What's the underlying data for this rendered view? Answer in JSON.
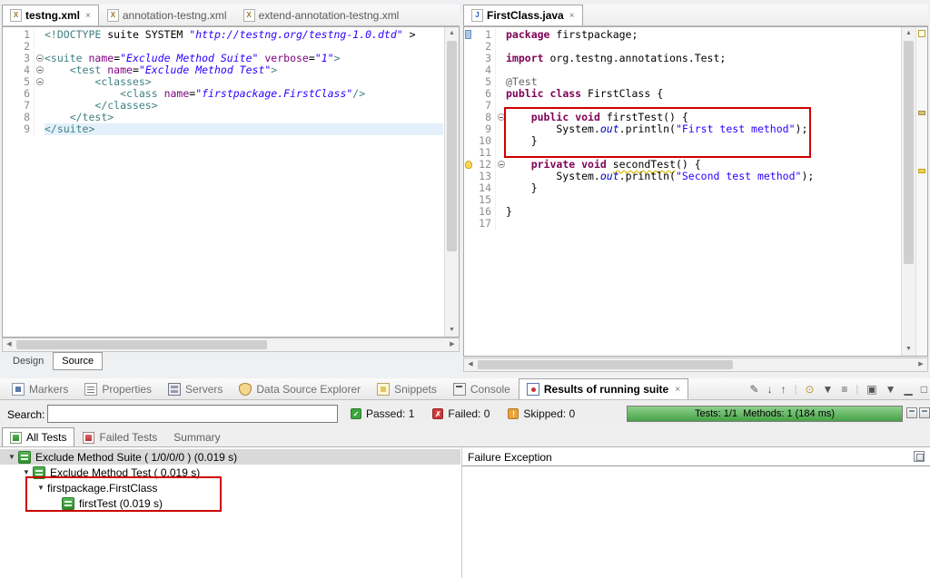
{
  "icons": {
    "close": "×",
    "xml_file": "X",
    "java_file": "J",
    "scroll_up": "▲",
    "scroll_down": "▼",
    "scroll_left": "◀",
    "scroll_right": "▶",
    "tree_expanded": "▼"
  },
  "left_editor": {
    "tabs": [
      {
        "label": "testng.xml",
        "icon": "xml",
        "active": true,
        "closable": true
      },
      {
        "label": "annotation-testng.xml",
        "icon": "xml"
      },
      {
        "label": "extend-annotation-testng.xml",
        "icon": "xml"
      }
    ],
    "bottom_tabs": [
      {
        "label": "Design"
      },
      {
        "label": "Source",
        "active": true
      }
    ],
    "lines": [
      {
        "n": "1",
        "seg": [
          [
            "t",
            "<!DOCTYPE "
          ],
          [
            "p",
            "suite SYSTEM "
          ],
          [
            "v",
            "\"http://testng.org/testng-1.0.dtd\""
          ],
          [
            "p",
            " >"
          ]
        ]
      },
      {
        "n": "2",
        "seg": []
      },
      {
        "n": "3",
        "fold": true,
        "seg": [
          [
            "t",
            "<suite "
          ],
          [
            "a",
            "name"
          ],
          [
            "p",
            "="
          ],
          [
            "v",
            "\"Exclude Method Suite\""
          ],
          [
            "p",
            " "
          ],
          [
            "a",
            "verbose"
          ],
          [
            "p",
            "="
          ],
          [
            "v",
            "\"1\""
          ],
          [
            "t",
            ">"
          ]
        ]
      },
      {
        "n": "4",
        "fold": true,
        "seg": [
          [
            "p",
            "    "
          ],
          [
            "t",
            "<test "
          ],
          [
            "a",
            "name"
          ],
          [
            "p",
            "="
          ],
          [
            "v",
            "\"Exclude Method Test\""
          ],
          [
            "t",
            ">"
          ]
        ]
      },
      {
        "n": "5",
        "fold": true,
        "seg": [
          [
            "p",
            "        "
          ],
          [
            "t",
            "<classes>"
          ]
        ]
      },
      {
        "n": "6",
        "seg": [
          [
            "p",
            "            "
          ],
          [
            "t",
            "<class "
          ],
          [
            "a",
            "name"
          ],
          [
            "p",
            "="
          ],
          [
            "v",
            "\"firstpackage.FirstClass\""
          ],
          [
            "t",
            "/>"
          ]
        ]
      },
      {
        "n": "7",
        "seg": [
          [
            "p",
            "        "
          ],
          [
            "t",
            "</classes>"
          ]
        ]
      },
      {
        "n": "8",
        "seg": [
          [
            "p",
            "    "
          ],
          [
            "t",
            "</test>"
          ]
        ]
      },
      {
        "n": "9",
        "hl": true,
        "seg": [
          [
            "t",
            "</suite>"
          ]
        ]
      }
    ]
  },
  "right_editor": {
    "tabs": [
      {
        "label": "FirstClass.java",
        "icon": "java",
        "active": true,
        "closable": true
      }
    ],
    "lines": [
      {
        "n": "1",
        "mark": "range",
        "seg": [
          [
            "k",
            "package"
          ],
          [
            "p",
            " firstpackage;"
          ]
        ]
      },
      {
        "n": "2",
        "seg": []
      },
      {
        "n": "3",
        "seg": [
          [
            "k",
            "import"
          ],
          [
            "p",
            " org.testng.annotations.Test;"
          ]
        ]
      },
      {
        "n": "4",
        "seg": []
      },
      {
        "n": "5",
        "seg": [
          [
            "an",
            "@Test"
          ]
        ]
      },
      {
        "n": "6",
        "seg": [
          [
            "k",
            "public"
          ],
          [
            "p",
            " "
          ],
          [
            "k",
            "class"
          ],
          [
            "p",
            " FirstClass {"
          ]
        ]
      },
      {
        "n": "7",
        "seg": []
      },
      {
        "n": "8",
        "fold": true,
        "seg": [
          [
            "p",
            "    "
          ],
          [
            "k",
            "public"
          ],
          [
            "p",
            " "
          ],
          [
            "k",
            "void"
          ],
          [
            "p",
            " firstTest() {"
          ]
        ]
      },
      {
        "n": "9",
        "seg": [
          [
            "p",
            "        System."
          ],
          [
            "st",
            "out"
          ],
          [
            "p",
            ".println("
          ],
          [
            "s",
            "\"First test method\""
          ],
          [
            "p",
            ");"
          ]
        ]
      },
      {
        "n": "10",
        "seg": [
          [
            "p",
            "    }"
          ]
        ]
      },
      {
        "n": "11",
        "seg": []
      },
      {
        "n": "12",
        "fold": true,
        "bulb": true,
        "seg": [
          [
            "p",
            "    "
          ],
          [
            "k",
            "private"
          ],
          [
            "p",
            " "
          ],
          [
            "k",
            "void"
          ],
          [
            "p",
            " "
          ],
          [
            "w",
            "secondTest"
          ],
          [
            "p",
            "() {"
          ]
        ]
      },
      {
        "n": "13",
        "seg": [
          [
            "p",
            "        System."
          ],
          [
            "st",
            "out"
          ],
          [
            "p",
            ".println("
          ],
          [
            "s",
            "\"Second test method\""
          ],
          [
            "p",
            ");"
          ]
        ]
      },
      {
        "n": "14",
        "seg": [
          [
            "p",
            "    }"
          ]
        ]
      },
      {
        "n": "15",
        "seg": []
      },
      {
        "n": "16",
        "seg": [
          [
            "p",
            "}"
          ]
        ]
      },
      {
        "n": "17",
        "seg": []
      }
    ]
  },
  "results_panel": {
    "tabs": [
      {
        "label": "Markers",
        "icon": "markers"
      },
      {
        "label": "Properties",
        "icon": "properties"
      },
      {
        "label": "Servers",
        "icon": "servers"
      },
      {
        "label": "Data Source Explorer",
        "icon": "datasource"
      },
      {
        "label": "Snippets",
        "icon": "snippets"
      },
      {
        "label": "Console",
        "icon": "console"
      },
      {
        "label": "Results of running suite",
        "icon": "results",
        "active": true,
        "closable": true
      }
    ],
    "toolbar_icons": [
      {
        "name": "new-report-icon",
        "glyph": "✎"
      },
      {
        "name": "next-failure-icon",
        "glyph": "↓"
      },
      {
        "name": "previous-failure-icon",
        "glyph": "↑"
      },
      {
        "name": "separator",
        "glyph": "|"
      },
      {
        "name": "key-icon",
        "glyph": "⊙",
        "color": "#b8962e"
      },
      {
        "name": "filter-icon",
        "glyph": "▼"
      },
      {
        "name": "history-icon",
        "glyph": "≡"
      },
      {
        "name": "separator",
        "glyph": "|"
      },
      {
        "name": "detach-icon",
        "glyph": "▣"
      },
      {
        "name": "view-menu-icon",
        "glyph": "▼"
      },
      {
        "name": "minimize-icon",
        "glyph": "▁"
      },
      {
        "name": "maximize-icon",
        "glyph": "□"
      }
    ],
    "search_label": "Search:",
    "search_value": "",
    "stats": [
      {
        "type": "passed",
        "label": "Passed: 1",
        "glyph": "✓"
      },
      {
        "type": "failed",
        "label": "Failed: 0",
        "glyph": "✗"
      },
      {
        "type": "skipped",
        "label": "Skipped: 0",
        "glyph": "!"
      }
    ],
    "progress_text": "Tests: 1/1  Methods: 1 (184 ms)",
    "view_tabs": [
      {
        "label": "All Tests",
        "icon": "alltests",
        "active": true
      },
      {
        "label": "Failed Tests",
        "icon": "failedtests"
      },
      {
        "label": "Summary"
      }
    ],
    "tree": [
      {
        "level": 0,
        "expanded": true,
        "icon": "suite",
        "label": "Exclude Method Suite ( 1/0/0/0 ) (0.019 s)",
        "selected": true
      },
      {
        "level": 1,
        "expanded": true,
        "icon": "suite",
        "label": "Exclude Method Test ( 0.019 s)"
      },
      {
        "level": 2,
        "expanded": true,
        "label": "firstpackage.FirstClass"
      },
      {
        "level": 3,
        "icon": "test",
        "label": "firstTest (0.019 s)"
      }
    ],
    "failure_header": "Failure Exception"
  }
}
